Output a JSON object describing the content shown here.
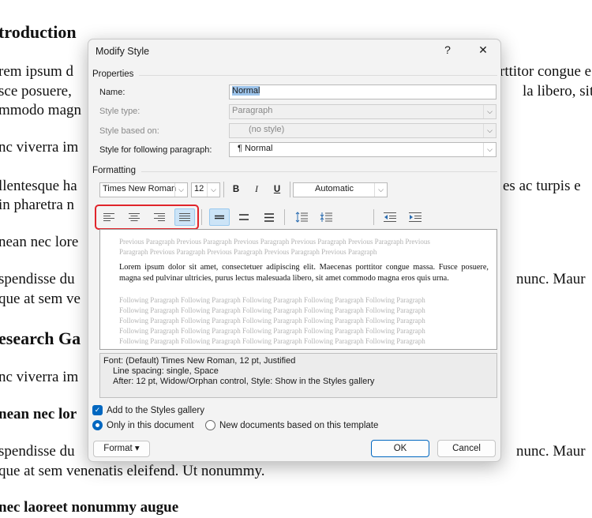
{
  "document": {
    "lines": [
      {
        "left": "troduction",
        "right": ""
      },
      {
        "left": "rem ipsum d",
        "right": "rttitor congue e"
      },
      {
        "left": "sce posuere,",
        "right": "la libero, sit"
      },
      {
        "left": "mmodo magn",
        "right": ""
      },
      {
        "left": "nc viverra im",
        "right": ""
      },
      {
        "left": "llentesque ha",
        "right": "es ac turpis e"
      },
      {
        "left": "in pharetra n",
        "right": ""
      },
      {
        "left": "nean nec lore",
        "right": ""
      },
      {
        "left": "spendisse du",
        "right": "nunc. Maur"
      },
      {
        "left": "que at sem ve",
        "right": ""
      },
      {
        "left": "esearch Ga",
        "right": ""
      },
      {
        "left": "nc viverra im",
        "right": ""
      },
      {
        "left": "nean nec lor",
        "right": ""
      },
      {
        "left": "spendisse du",
        "right": "nunc. Maur"
      },
      {
        "left": "que at sem venenatis eleifend. Ut nonummy.",
        "right": ""
      },
      {
        "left": "nec laoreet nonummy augue",
        "right": ""
      }
    ]
  },
  "dialog": {
    "title": "Modify Style",
    "help": "?",
    "close": "✕",
    "properties": {
      "heading": "Properties",
      "name_label": "Name:",
      "name_value": "Normal",
      "style_type_label": "Style type:",
      "style_type_value": "Paragraph",
      "based_on_label": "Style based on:",
      "based_on_value": "(no style)",
      "following_label": "Style for following paragraph:",
      "following_value": "¶  Normal"
    },
    "formatting": {
      "heading": "Formatting",
      "font": "Times New Roman",
      "size": "12",
      "bold": "B",
      "italic": "I",
      "underline": "U",
      "color": "Automatic"
    },
    "preview": {
      "previous": "Previous Paragraph Previous Paragraph Previous Paragraph Previous Paragraph Previous Paragraph Previous Paragraph Previous Paragraph Previous Paragraph Previous Paragraph Previous Paragraph",
      "current": "Lorem ipsum dolor sit amet, consectetuer adipiscing elit. Maecenas porttitor congue massa. Fusce posuere, magna sed pulvinar ultricies, purus lectus malesuada libero, sit amet commodo magna eros quis urna.",
      "following": "Following Paragraph Following Paragraph Following Paragraph Following Paragraph Following Paragraph Following Paragraph Following Paragraph Following Paragraph Following Paragraph Following Paragraph Following Paragraph Following Paragraph Following Paragraph Following Paragraph Following Paragraph Following Paragraph Following Paragraph Following Paragraph Following Paragraph Following Paragraph Following Paragraph Following Paragraph Following Paragraph Following Paragraph Following Paragraph"
    },
    "description": {
      "line1": "Font: (Default) Times New Roman, 12 pt, Justified",
      "line2": "Line spacing:  single, Space",
      "line3": "After:  12 pt, Widow/Orphan control, Style: Show in the Styles gallery"
    },
    "add_to_gallery": "Add to the Styles gallery",
    "only_this_doc": "Only in this document",
    "new_docs": "New documents based on this template",
    "format_btn": "Format ▾",
    "ok": "OK",
    "cancel": "Cancel",
    "colors": {
      "accent": "#0067c0",
      "highlight": "#e0242b"
    }
  }
}
